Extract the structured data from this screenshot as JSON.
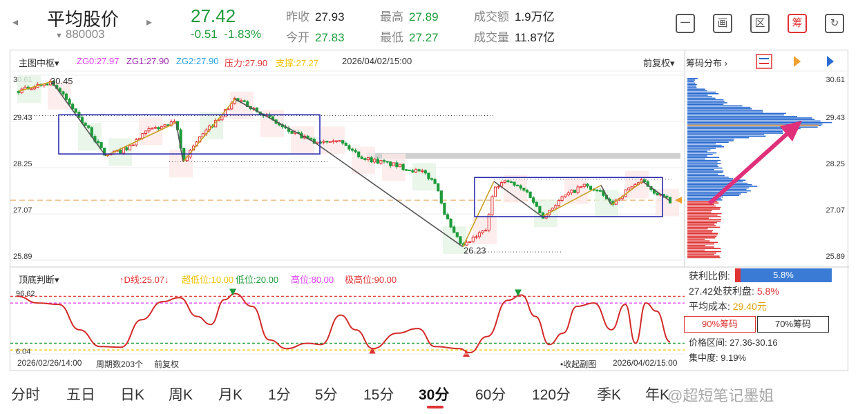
{
  "header": {
    "prev_icon": "◂",
    "next_icon": "▸",
    "name": "平均股价",
    "code": "880003",
    "price": "27.42",
    "change": "-0.51",
    "change_pct": "-1.83%",
    "stats": [
      {
        "label": "昨收",
        "value": "27.93",
        "color": "dark"
      },
      {
        "label": "今开",
        "value": "27.83",
        "color": "green"
      },
      {
        "label": "最高",
        "value": "27.89",
        "color": "green"
      },
      {
        "label": "最低",
        "value": "27.27",
        "color": "green"
      },
      {
        "label": "成交额",
        "value": "1.9万亿",
        "color": "dark"
      },
      {
        "label": "成交量",
        "value": "11.87亿",
        "color": "dark"
      }
    ],
    "tools": [
      "一",
      "画",
      "区",
      "筹",
      "↻"
    ]
  },
  "main_chart": {
    "label": "主图中枢",
    "indicators": [
      {
        "text": "ZG0:27.97",
        "color": "#e040fb"
      },
      {
        "text": "ZG1:27.90",
        "color": "#9c27b0"
      },
      {
        "text": "ZG2:27.90",
        "color": "#29a3e0"
      },
      {
        "text": "压力:27.90",
        "color": "#e03333"
      },
      {
        "text": "支撑:27.27",
        "color": "#f2c200"
      }
    ],
    "date": "2026/04/02/15:00",
    "adjust": "前复权",
    "chip_dist": "筹码分布",
    "axis_labels": [
      "30.61",
      "29.43",
      "28.25",
      "27.07",
      "25.89"
    ],
    "high_marker": "30.45",
    "low_marker": "26.23"
  },
  "sub_chart": {
    "label": "顶底判断",
    "indicators": [
      {
        "text": "↑D线:25.07↓",
        "color": "#e03333"
      },
      {
        "text": "超低位:10.00",
        "color": "#f2c200"
      },
      {
        "text": "低位:20.00",
        "color": "#1e9b3a"
      },
      {
        "text": "高位:80.00",
        "color": "#e040fb"
      },
      {
        "text": "极高位:90.00",
        "color": "#e03333"
      }
    ],
    "top_value": "96.62",
    "bottom_value": "6.04",
    "start_date": "2026/02/26/14:00",
    "period_count": "周期数203个",
    "adjust": "前复权",
    "collapse": "收起副图",
    "end_date": "2026/04/02/15:00"
  },
  "chip_panel": {
    "axis_labels": [
      "30.61",
      "29.43",
      "28.25",
      "27.07",
      "25.89"
    ],
    "profit_ratio_label": "获利比例:",
    "profit_ratio": "5.8%",
    "profit_ratio_value": 0.058,
    "profit_at_label": "27.42处获利盘:",
    "profit_at": "5.8%",
    "avg_cost_label": "平均成本:",
    "avg_cost": "29.40元",
    "btn_90": "90%筹码",
    "btn_70": "70%筹码",
    "range_label": "价格区间:",
    "range": "27.36-30.16",
    "concentration_label": "集中度:",
    "concentration": "9.19%"
  },
  "tabs": [
    "分时",
    "五日",
    "日K",
    "周K",
    "月K",
    "1分",
    "5分",
    "15分",
    "30分",
    "60分",
    "120分",
    "季K",
    "年K"
  ],
  "active_tab": "30分",
  "watermark": "@超短笔记墨姐",
  "colors": {
    "up": "#e03333",
    "down": "#1e9b3a",
    "box": "#2b2bb0",
    "chip_blue": "#2a6bd1"
  }
}
